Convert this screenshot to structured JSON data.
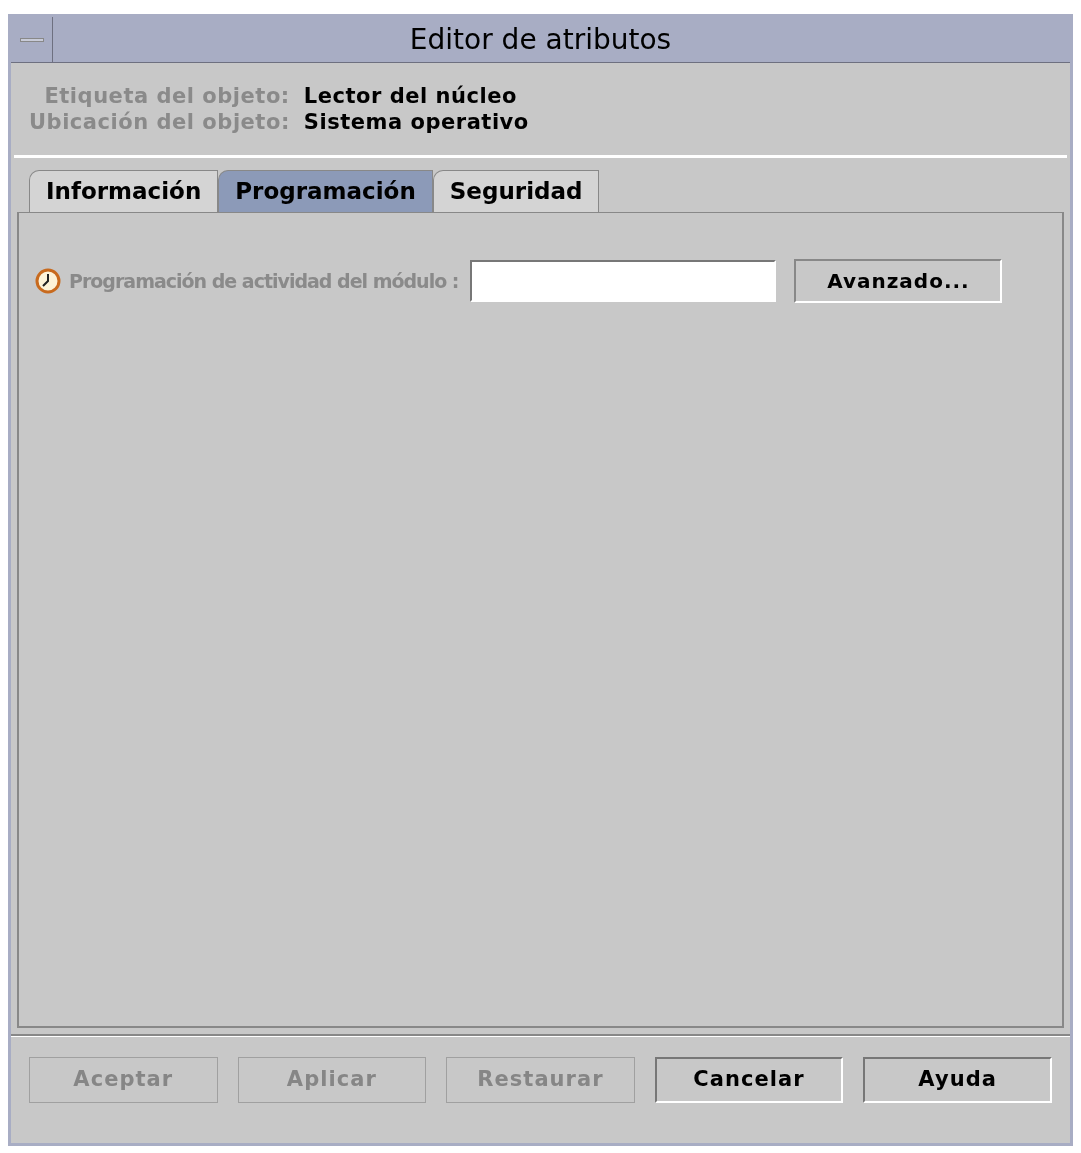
{
  "window": {
    "title": "Editor de atributos"
  },
  "info": [
    {
      "label": "Etiqueta del objeto:",
      "value": "Lector del núcleo"
    },
    {
      "label": "Ubicación del objeto:",
      "value": "Sistema operativo"
    }
  ],
  "tabs": [
    {
      "label": "Información",
      "selected": false
    },
    {
      "label": "Programación",
      "selected": true
    },
    {
      "label": "Seguridad",
      "selected": false
    }
  ],
  "schedule": {
    "label": "Programación de actividad del módulo :",
    "button": "Avanzado..."
  },
  "buttons": [
    {
      "label": "Aceptar",
      "disabled": true
    },
    {
      "label": "Aplicar",
      "disabled": true
    },
    {
      "label": "Restaurar",
      "disabled": true
    },
    {
      "label": "Cancelar",
      "disabled": false
    },
    {
      "label": "Ayuda",
      "disabled": false
    }
  ]
}
